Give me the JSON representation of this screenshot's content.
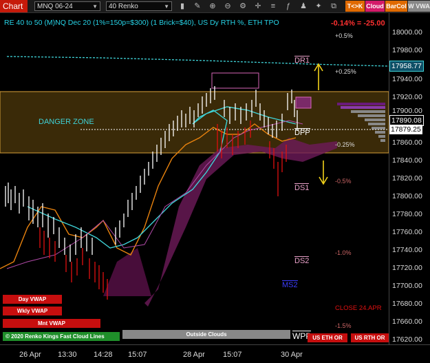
{
  "toolbar": {
    "chart_tab": "Chart",
    "instrument": "MNQ 06-24",
    "bar_type": "40 Renko",
    "tk_label": "T<>K",
    "cloud_label": "Cloud",
    "barcol_label": "BarCol",
    "vwa_label": "W VWA"
  },
  "header": {
    "title": "RE 40 to 50 (M)NQ Dec 20 (1%=150p=$300) (1 Brick=$40), US Dy RTH %, ETH TPO",
    "change": "-0.14% = -25.00"
  },
  "levels": {
    "p05": "+0.5%",
    "p025": "+0.25%",
    "m025": "-0.25%",
    "m05": "-0.5%",
    "m10": "-1.0%",
    "m15": "-1.5%",
    "dr1": "DR1",
    "dpp": "DPP",
    "ds1": "DS1",
    "ds2": "DS2",
    "ms2": "MS2",
    "wpp": "WPP",
    "close": "CLOSE 24.APR",
    "danger": "DANGER ZONE"
  },
  "buttons": {
    "day_vwap": "Day VWAP",
    "wkly_vwap": "Wkly VWAP",
    "mnt_vwap": "Mnt VWAP",
    "renko": "© 2020 Renko Kings Fast Cloud Lines",
    "outside": "Outside Clouds",
    "us_eth": "US ETH OR",
    "us_rth": "US RTH OR"
  },
  "price_axis": {
    "ticks": [
      "18000.00",
      "17980.00",
      "17960.00",
      "17940.00",
      "17920.00",
      "17900.00",
      "17880.00",
      "17860.00",
      "17840.00",
      "17820.00",
      "17800.00",
      "17780.00",
      "17760.00",
      "17740.00",
      "17720.00",
      "17700.00",
      "17680.00",
      "17660.00",
      "17640.00",
      "17620.00"
    ],
    "current": "17879.25",
    "marker_cyan": "17958.77",
    "marker_white": "17890.08"
  },
  "time_axis": [
    "26 Apr",
    "13:30",
    "14:28",
    "15:07",
    "28 Apr",
    "15:07",
    "30 Apr"
  ],
  "colors": {
    "danger_fill": "#3a2a08",
    "danger_border": "#d9a13a",
    "cloud_magenta": "#6e1a5a",
    "orange": "#e8820e",
    "cyan": "#3fd3d8",
    "red": "#e01010",
    "accent_red": "#c61a0a"
  }
}
